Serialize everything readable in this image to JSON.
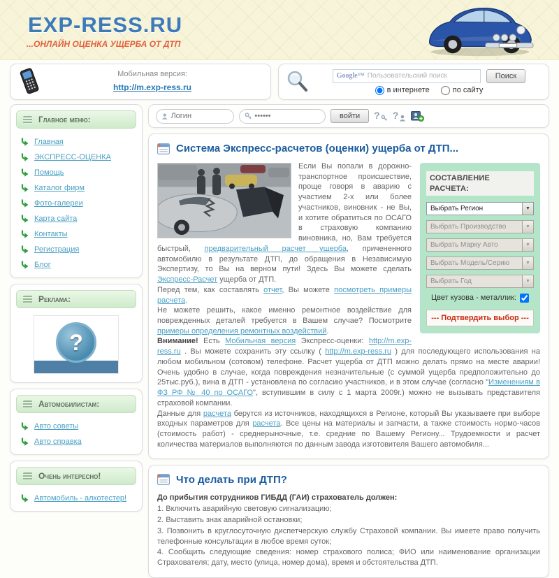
{
  "colors": {
    "logo_blue": "#3d7ab9",
    "tagline_orange": "#e2603d",
    "link_blue": "#4aa0c4",
    "panel_green": "#b5e5c8",
    "confirm_red": "#cb2a10",
    "header_bg": "#f7f4d9"
  },
  "icons": {
    "help": "?",
    "question_mark": "?",
    "select_arrow": "▼"
  },
  "header": {
    "logo": "EXP-RESS.RU",
    "tagline": "...ОНЛАЙН ОЦЕНКА УЩЕРБА ОТ ДТП"
  },
  "mobile_box": {
    "label": "Мобильная версия:",
    "link": "http://m.exp-ress.ru"
  },
  "search_box": {
    "google_label": "Google™",
    "placeholder": "Пользовательский поиск",
    "button": "Поиск",
    "radio_internet": "в интернете",
    "radio_site": "по сайту",
    "radio_internet_checked": "true"
  },
  "login_bar": {
    "login_placeholder": "Логин",
    "password_value": "••••••",
    "submit": "войти"
  },
  "sidebar": {
    "main_menu": {
      "title": "Главное меню:",
      "items": [
        "Главная",
        "ЭКСПРЕСС-ОЦЕНКА",
        "Помощь",
        "Каталог фирм",
        "Фото-галереи",
        "Карта сайта",
        "Контакты",
        "Регистрация",
        "Блог"
      ]
    },
    "ads": {
      "title": "Реклама:"
    },
    "motorists": {
      "title": "Автомобилистам:",
      "items": [
        "Авто советы",
        "Авто справка"
      ]
    },
    "interesting": {
      "title": "Очень интересно!",
      "items": [
        "Автомобиль - алкотестер!"
      ]
    }
  },
  "article1": {
    "title": "Система Экспресс-расчетов (оценки) ущерба от ДТП...",
    "segments": [
      {
        "t": "Если Вы попали в дорожно-транспортное происшествие, проще говоря в аварию с участием 2-х или более участников, виновник - не Вы, и хотите обратиться по ОСАГО в страховую компанию виновника, но, Вам требуется быстрый, "
      },
      {
        "t": "предварительный расчет ущерба",
        "s": "link"
      },
      {
        "t": ", причененного автомобилю в результате ДТП,  до обращения в Независимую Экспертизу, то Вы на верном пути! Здесь Вы можете сделать "
      },
      {
        "t": "Экспресс-Расчет",
        "s": "link"
      },
      {
        "t": " ущерба от ДТП.\nПеред тем, как составлять "
      },
      {
        "t": "отчет",
        "s": "link"
      },
      {
        "t": ", Вы можете "
      },
      {
        "t": "посмотреть примеры расчета",
        "s": "link"
      },
      {
        "t": ".\nНе можете решить, какое именно ремонтное воздействие для поврежденных деталей требуется в Вашем случае? Посмотрите "
      },
      {
        "t": "примеры определения ремонтных воздействий",
        "s": "link"
      },
      {
        "t": ".\n"
      },
      {
        "t": "Внимание!",
        "s": "bold"
      },
      {
        "t": " Есть "
      },
      {
        "t": "Мобильная версия",
        "s": "link"
      },
      {
        "t": " Экспресс-оценки: "
      },
      {
        "t": "http://m.exp-ress.ru",
        "s": "link"
      },
      {
        "t": " . Вы можете сохранить эту ссылку ( "
      },
      {
        "t": "http://m.exp-ress.ru",
        "s": "link"
      },
      {
        "t": " ) для последующего использования на любом мобильном (сотовом) телефоне. Расчет ущерба от ДТП можно делать прямо на месте аварии! Очень удобно в случае, когда повреждения незначительные (с суммой ущерба предположительно до 25тыс.руб.), вина в ДТП - установлена по согласию участников, и в этом случае (согласно \""
      },
      {
        "t": "Изменениям в ФЗ РФ № 40 по ОСАГО",
        "s": "link"
      },
      {
        "t": "\", вступившим в силу с 1 марта 2009г.) можно не вызывать представителя страховой компании.\nДанные для "
      },
      {
        "t": "расчета",
        "s": "link"
      },
      {
        "t": " берутся из источников, находящихся в Регионе, который Вы указываете при выборе входных параметров для "
      },
      {
        "t": "расчета",
        "s": "link"
      },
      {
        "t": ". Все цены на материалы и запчасти, а также стоимость нормо-часов (стоимость работ) - среднерыночные, т.е. средние по Вашему Региону... Трудоемкости и расчет количества материалов выполняются по данным завода изготовителя Вашего автомобиля..."
      }
    ]
  },
  "calc_panel": {
    "title": "СОСТАВЛЕНИЕ РАСЧЕТА:",
    "selects": [
      "Выбрать Регион",
      "Выбрать Производство",
      "Выбрать Марку Авто",
      "Выбрать Модель/Серию",
      "Выбрать Год"
    ],
    "checkbox_label": "Цвет кузова - металлик:",
    "checkbox_checked": "true",
    "confirm": "--- Подтвердить выбор ---"
  },
  "article2": {
    "title": "Что делать при ДТП?",
    "bold_intro": "До прибытия сотрудников ГИБДД (ГАИ) страхователь должен:",
    "list": [
      "1. Включить аварийную световую сигнализацию;",
      "2. Выставить знак аварийной остановки;",
      "3. Позвонить в круглосуточную диспетчерскую службу Страховой компании. Вы имеете право получить телефонные консультации в любое время суток;",
      "4. Сообщить следующие сведения: номер страхового полиса; ФИО или наименование организации Страхователя; дату, место (улица, номер дома), время и обстоятельства ДТП."
    ]
  }
}
